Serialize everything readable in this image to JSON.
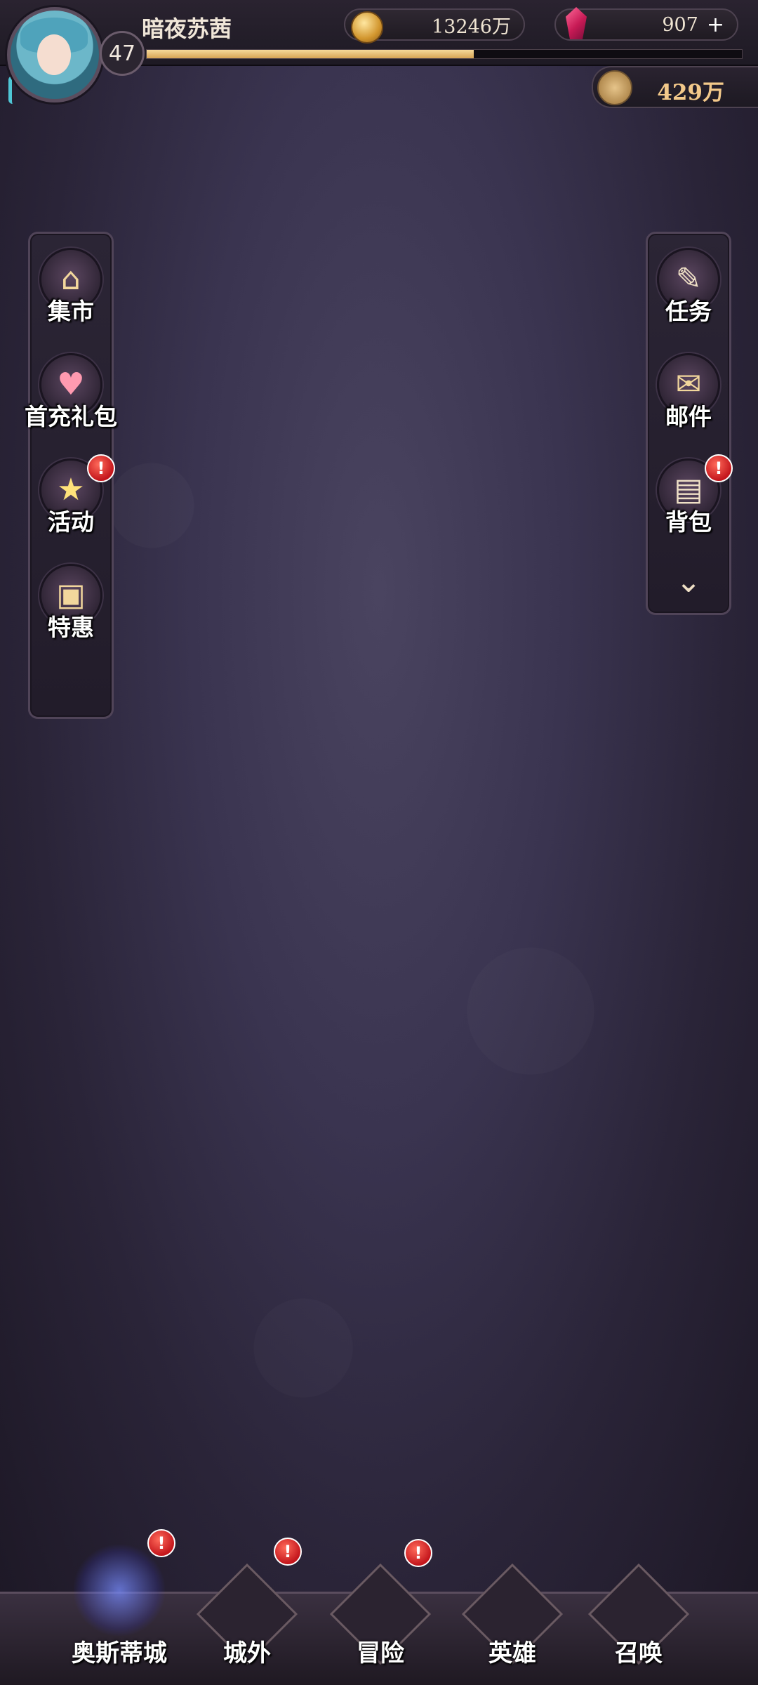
{
  "player": {
    "name": "暗夜苏茜",
    "level": "47",
    "exp_fraction": 0.55
  },
  "resources": {
    "gold": "13246万",
    "gems": "907",
    "tickets": "429万"
  },
  "left_menu": [
    {
      "label": "集市",
      "icon": "market-stall-icon",
      "badge": ""
    },
    {
      "label": "首充礼包",
      "icon": "first-recharge-character-icon",
      "badge": ""
    },
    {
      "label": "活动",
      "icon": "star-icon",
      "badge": "!"
    },
    {
      "label": "特惠",
      "icon": "gift-box-icon",
      "badge": ""
    }
  ],
  "right_menu": [
    {
      "label": "任务",
      "icon": "quill-scroll-icon",
      "badge": ""
    },
    {
      "label": "邮件",
      "icon": "envelope-icon",
      "badge": ""
    },
    {
      "label": "背包",
      "icon": "backpack-icon",
      "badge": "!"
    }
  ],
  "bottom_nav": [
    {
      "label": "奥斯蒂城",
      "icon": "city-icon",
      "badge": "!",
      "active": true
    },
    {
      "label": "城外",
      "icon": "airship-icon",
      "badge": "!",
      "active": false
    },
    {
      "label": "冒险",
      "icon": "portal-icon",
      "badge": "!",
      "active": false
    },
    {
      "label": "英雄",
      "icon": "hero-portrait-icon",
      "badge": "",
      "active": false
    },
    {
      "label": "召唤",
      "icon": "angel-statue-icon",
      "badge": "",
      "active": false
    }
  ],
  "badge_symbol": "!",
  "colors": {
    "accent_gold": "#f3c98a",
    "exp_bar": "#e6b766",
    "alert_red": "#d8201f"
  }
}
